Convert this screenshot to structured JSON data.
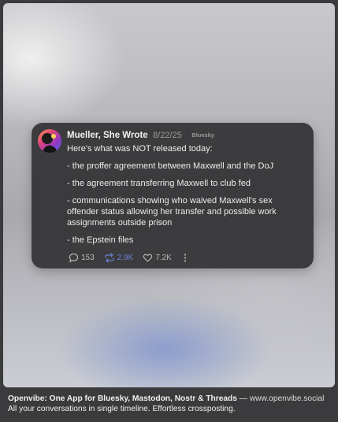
{
  "post": {
    "author": "Mueller, She Wrote",
    "date": "8/22/25",
    "platform": "Bluesky",
    "paragraphs": [
      "Here's what was NOT released today:",
      "- the proffer agreement between Maxwell and the DoJ",
      "- the agreement transferring Maxwell to club fed",
      "- communications showing who waived Maxwell's sex offender status allowing her transfer and possible work assignments outside prison",
      "- the Epstein files"
    ],
    "actions": {
      "replies": "153",
      "reposts": "2.9K",
      "likes": "7.2K"
    },
    "icons": {
      "reply": "speech-bubble-icon",
      "repost": "repost-arrows-icon",
      "like": "heart-icon",
      "more": "vertical-ellipsis-icon"
    },
    "colors": {
      "repost_active": "#6a82d9"
    }
  },
  "footer": {
    "headline": "Openvibe: One App for Bluesky, Mastodon, Nostr & Threads",
    "separator": " — ",
    "url": "www.openvibe.social",
    "tagline": "All your conversations in single timeline. Effortless crossposting."
  }
}
